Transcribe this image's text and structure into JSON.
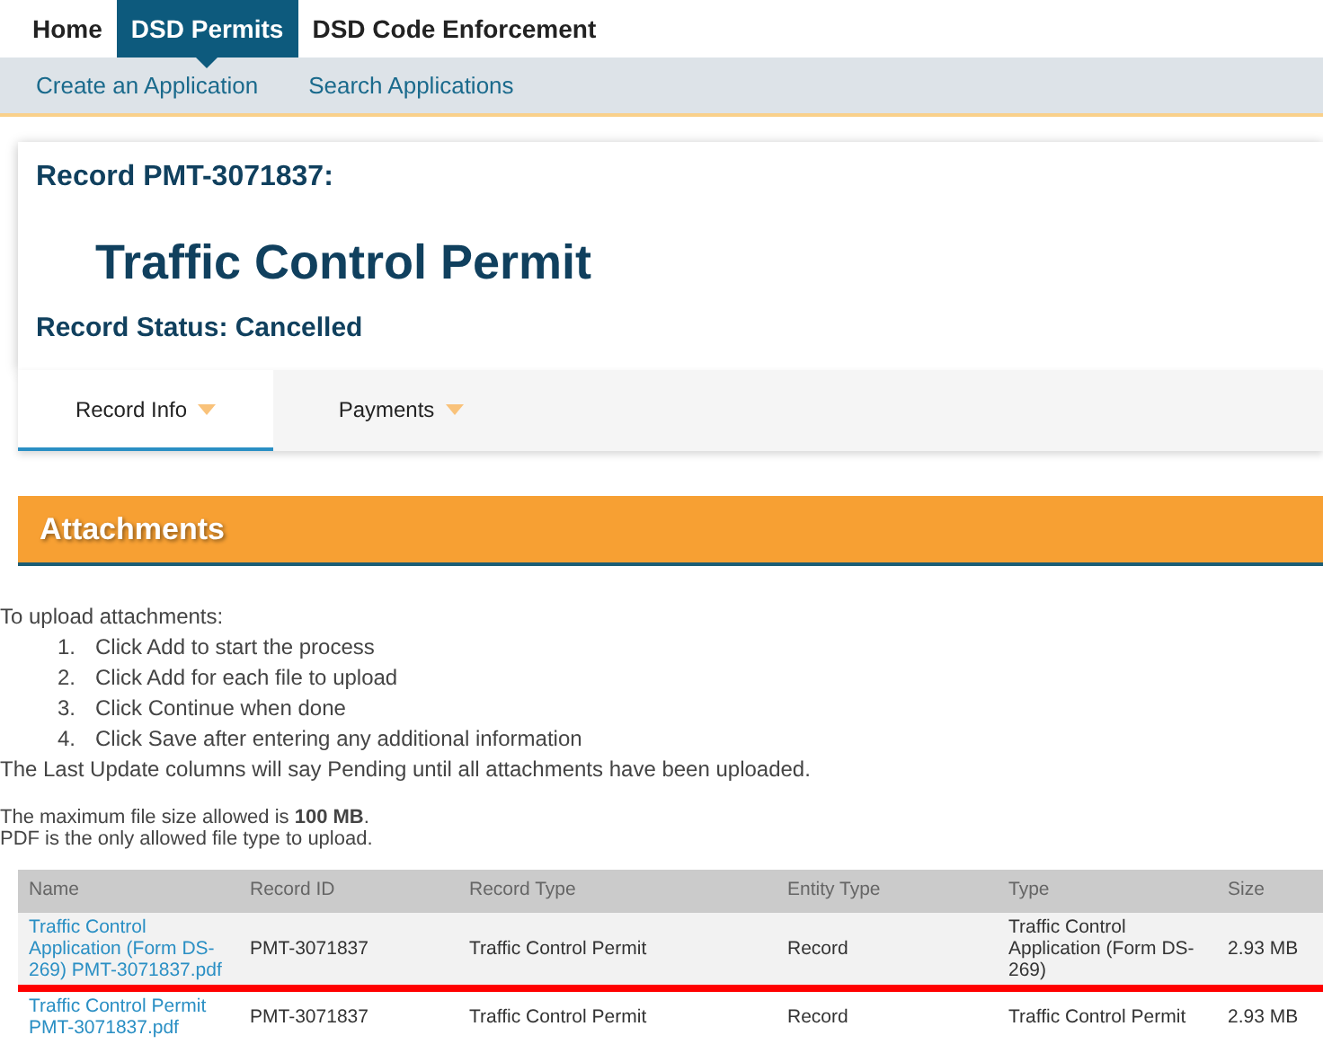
{
  "nav_tabs": [
    {
      "label": "Home",
      "selected": false
    },
    {
      "label": "DSD Permits",
      "selected": true
    },
    {
      "label": "DSD Code Enforcement",
      "selected": false
    }
  ],
  "sub_nav": [
    "Create an Application",
    "Search Applications"
  ],
  "record": {
    "id_label": "Record PMT-3071837:",
    "title": "Traffic Control Permit",
    "status": "Record Status: Cancelled"
  },
  "record_tabs": [
    {
      "label": "Record Info",
      "selected": true
    },
    {
      "label": "Payments",
      "selected": false
    }
  ],
  "attachments": {
    "heading": "Attachments",
    "intro": "To upload attachments:",
    "steps": [
      {
        "number": "1.",
        "text": "Click Add to start the process"
      },
      {
        "number": "2.",
        "text": "Click Add for each file to upload"
      },
      {
        "number": "3.",
        "text": "Click Continue when done"
      },
      {
        "number": "4.",
        "text": "Click Save after entering any additional information"
      }
    ],
    "note": "The Last Update columns will say Pending until all attachments have been uploaded.",
    "limits": [
      "The maximum file size allowed is **100 MB**.",
      "PDF is the only allowed file type to upload."
    ],
    "table": {
      "columns": [
        "Name",
        "Record ID",
        "Record Type",
        "Entity Type",
        "Type",
        "Size"
      ],
      "rows": [
        {
          "cells": [
            "Traffic Control Application (Form DS-269) PMT-3071837.pdf",
            "PMT-3071837",
            "Traffic Control Permit",
            "Record",
            "Traffic Control Application (Form DS-269)",
            "2.93 MB"
          ],
          "highlighted": true
        },
        {
          "cells": [
            "Traffic Control Permit PMT-3071837.pdf",
            "PMT-3071837",
            "Traffic Control Permit",
            "Record",
            "Traffic Control Permit",
            "2.93 MB"
          ],
          "highlighted": false
        }
      ]
    }
  }
}
